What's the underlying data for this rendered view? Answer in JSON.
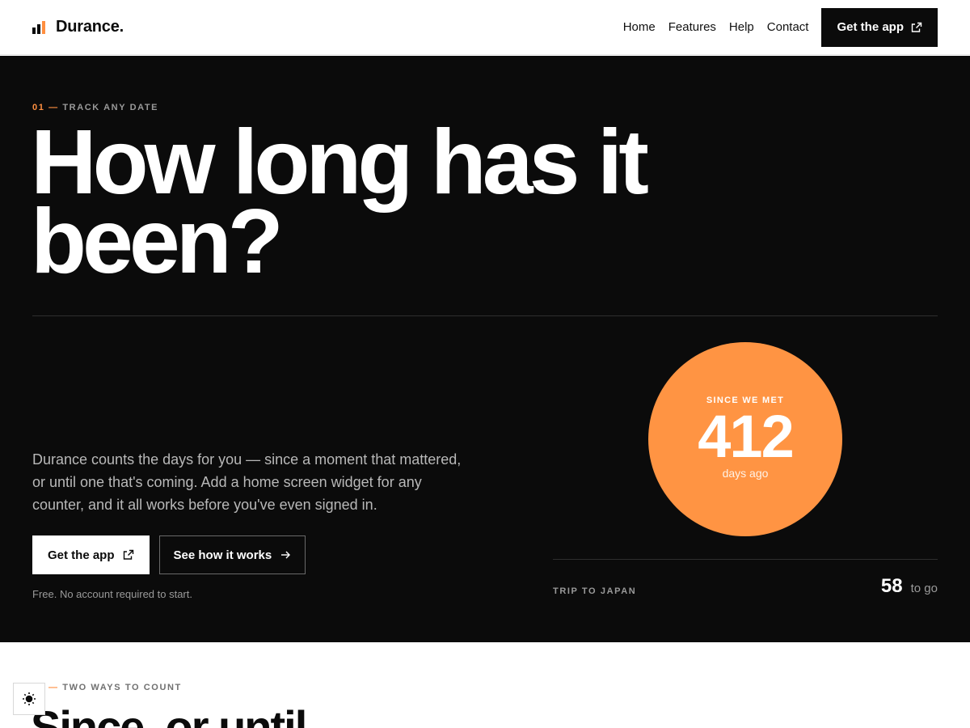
{
  "brand": {
    "name": "Durance."
  },
  "nav": {
    "links": [
      "Home",
      "Features",
      "Help",
      "Contact"
    ],
    "cta_label": "Get the app"
  },
  "hero": {
    "eyebrow_num": "01 —",
    "eyebrow_text": " TRACK ANY DATE",
    "headline_line1": "How long has it",
    "headline_line2": "been?",
    "lede": "Durance counts the days for you — since a moment that mattered, or until one that's coming. Add a home screen widget for any counter, and it all works before you've even signed in.",
    "primary_button": "Get the app",
    "secondary_button": "See how it works",
    "note": "Free. No account required to start.",
    "counter": {
      "label": "SINCE WE MET",
      "value": "412",
      "unit": "days ago"
    },
    "trip": {
      "label": "TRIP TO JAPAN",
      "count": "58",
      "suffix": "to go"
    }
  },
  "section2": {
    "eyebrow_dash": "—",
    "eyebrow_text": " TWO WAYS TO COUNT",
    "headline": "Since, or until."
  },
  "colors": {
    "accent": "#ff9443",
    "dark": "#0b0b0b"
  }
}
